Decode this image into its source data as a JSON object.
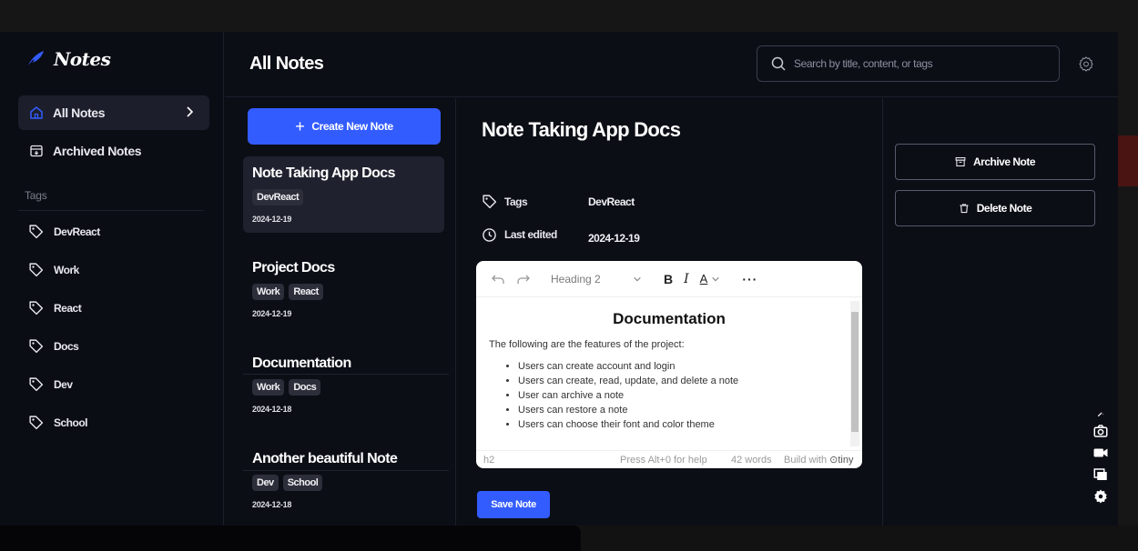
{
  "app": {
    "logo_text": "Notes"
  },
  "sidebar": {
    "nav": [
      {
        "label": "All Notes",
        "active": true
      },
      {
        "label": "Archived Notes",
        "active": false
      }
    ],
    "tags_heading": "Tags",
    "tags": [
      "DevReact",
      "Work",
      "React",
      "Docs",
      "Dev",
      "School"
    ]
  },
  "header": {
    "title": "All Notes",
    "search_placeholder": "Search by title, content, or tags"
  },
  "note_list": {
    "create_label": "Create New Note",
    "notes": [
      {
        "title": "Note Taking App Docs",
        "tags": [
          "DevReact"
        ],
        "date": "2024-12-19",
        "selected": true
      },
      {
        "title": "Project Docs",
        "tags": [
          "Work",
          "React"
        ],
        "date": "2024-12-19",
        "selected": false
      },
      {
        "title": "Documentation",
        "tags": [
          "Work",
          "Docs"
        ],
        "date": "2024-12-18",
        "selected": false
      },
      {
        "title": "Another beautiful Note",
        "tags": [
          "Dev",
          "School"
        ],
        "date": "2024-12-18",
        "selected": false
      }
    ]
  },
  "detail": {
    "title": "Note Taking App Docs",
    "tags_label": "Tags",
    "tags_value": "DevReact",
    "edited_label": "Last edited",
    "edited_value": "2024-12-19",
    "save_label": "Save Note"
  },
  "editor": {
    "heading_select": "Heading 2",
    "doc_title": "Documentation",
    "paragraph": "The following are the features of the project:",
    "bullets": [
      "Users can create account and login",
      "Users can create, read, update, and delete a note",
      "User can archive a note",
      "Users can restore a note",
      "Users can choose their font and color theme"
    ],
    "status_left": "h2",
    "status_help": "Press Alt+0 for help",
    "status_words": "42 words",
    "status_built": "Build with",
    "status_brand": "tiny"
  },
  "actions": {
    "archive_label": "Archive Note",
    "delete_label": "Delete Note"
  },
  "colors": {
    "accent": "#335cff",
    "background": "#0c0e16",
    "panel_selected": "#1f222e"
  }
}
